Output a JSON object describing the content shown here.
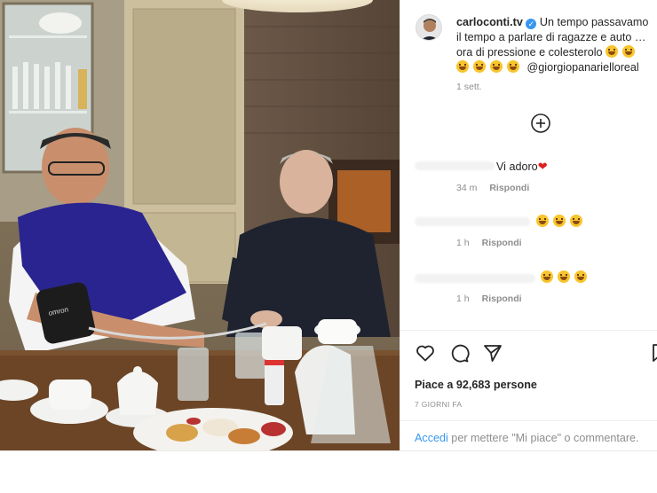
{
  "post": {
    "username": "carloconti.tv",
    "verified_mark": "✓",
    "caption_text": "Un tempo passavamo il tempo a parlare di ragazze e auto … ora di pressione e colesterolo",
    "mention": "@giorgiopanarielloreal",
    "caption_time": "1 sett.",
    "load_more_icon": "plus-circle-icon"
  },
  "comments": [
    {
      "text": "Vi adoro",
      "emoji": "heart",
      "time": "34 m",
      "reply_label": "Rispondi"
    },
    {
      "text": "",
      "emoji": "laughing-face x3",
      "time": "1 h",
      "reply_label": "Rispondi"
    },
    {
      "text": "",
      "emoji": "laughing-face x3",
      "time": "1 h",
      "reply_label": "Rispondi"
    }
  ],
  "actions": {
    "icons": [
      "heart-outline-icon",
      "comment-icon",
      "share-icon",
      "bookmark-icon"
    ]
  },
  "likes_text": "Piace a 92,683 persone",
  "post_date": "7 GIORNI FA",
  "login": {
    "link_label": "Accedi",
    "rest_text": " per mettere \"Mi piace\" o commentare."
  },
  "photo": {
    "scene": "photo",
    "monitor_brand": "omron"
  },
  "colors": {
    "accent": "#3897f0",
    "text": "#262626",
    "muted": "#8e8e8e",
    "heart": "#e02020",
    "verified": "#3897f0"
  }
}
